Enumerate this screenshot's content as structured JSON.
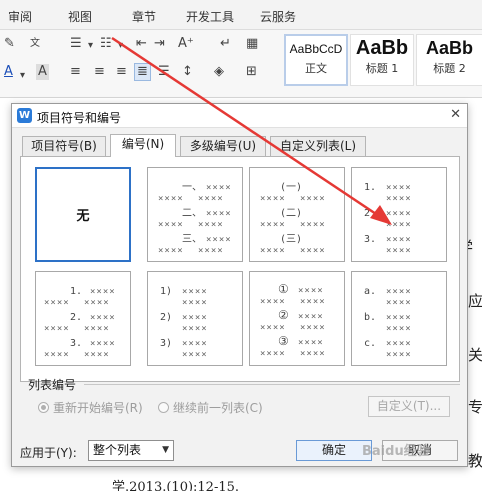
{
  "ribbon": {
    "tabs": [
      "审阅",
      "视图",
      "章节",
      "开发工具",
      "云服务"
    ],
    "styles": [
      {
        "sample": "AaBbCcD",
        "name": "正文"
      },
      {
        "sample": "AaBb",
        "name": "标题 1"
      },
      {
        "sample": "AaBb",
        "name": "标题 2"
      }
    ]
  },
  "document": {
    "line_fragments": [
      "学阝",
      "应",
      "关",
      "专",
      "教",
      "学.2013.(10):12-15."
    ]
  },
  "dialog": {
    "title": "项目符号和编号",
    "tabs": [
      "项目符号(B)",
      "编号(N)",
      "多级编号(U)",
      "自定义列表(L)"
    ],
    "active_tab": "编号(N)",
    "none_label": "无",
    "gallery_markers": [
      [
        "一、",
        "二、",
        "三、"
      ],
      [
        "(一)",
        "(二)",
        "(三)"
      ],
      [
        "1.",
        "2.",
        "3."
      ],
      [
        "1.",
        "2.",
        "3."
      ],
      [
        "1)",
        "2)",
        "3)"
      ],
      [
        "①",
        "②",
        "③"
      ],
      [
        "a.",
        "b.",
        "c."
      ]
    ],
    "placeholder_text": "××××",
    "list_numbering": {
      "label": "列表编号",
      "restart": "重新开始编号(R)",
      "continue": "继续前一列表(C)",
      "customize": "自定义(T)..."
    },
    "applies_to_label": "应用于(Y):",
    "applies_to_value": "整个列表",
    "ok": "确定",
    "cancel": "取消"
  },
  "annotation": {
    "color": "#e53935"
  },
  "watermark": "Baidu经验"
}
